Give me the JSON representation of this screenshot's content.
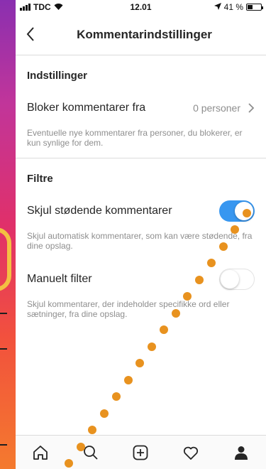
{
  "status_bar": {
    "carrier": "TDC",
    "time": "12.01",
    "battery": "41 %",
    "battery_level": 0.41
  },
  "nav": {
    "title": "Kommentarindstillinger",
    "back_icon": "chevron-left-icon"
  },
  "settings_section": {
    "heading": "Indstillinger",
    "block_label": "Bloker kommentarer fra",
    "block_value": "0 personer",
    "block_help": "Eventuelle nye kommentarer fra personer, du blokerer, er kun synlige for dem."
  },
  "filters_section": {
    "heading": "Filtre",
    "offensive_label": "Skjul stødende kommentarer",
    "offensive_on": true,
    "offensive_help": "Skjul automatisk kommentarer, som kan være stødende, fra dine opslag.",
    "manual_label": "Manuelt filter",
    "manual_on": false,
    "manual_help": "Skjul kommentarer, der indeholder specifikke ord eller sætninger, fra dine opslag."
  },
  "tabbar": {
    "items": [
      "home-icon",
      "search-icon",
      "add-post-icon",
      "activity-heart-icon",
      "profile-icon"
    ]
  },
  "colors": {
    "accent": "#3897f0",
    "dots": "#e8921f"
  }
}
